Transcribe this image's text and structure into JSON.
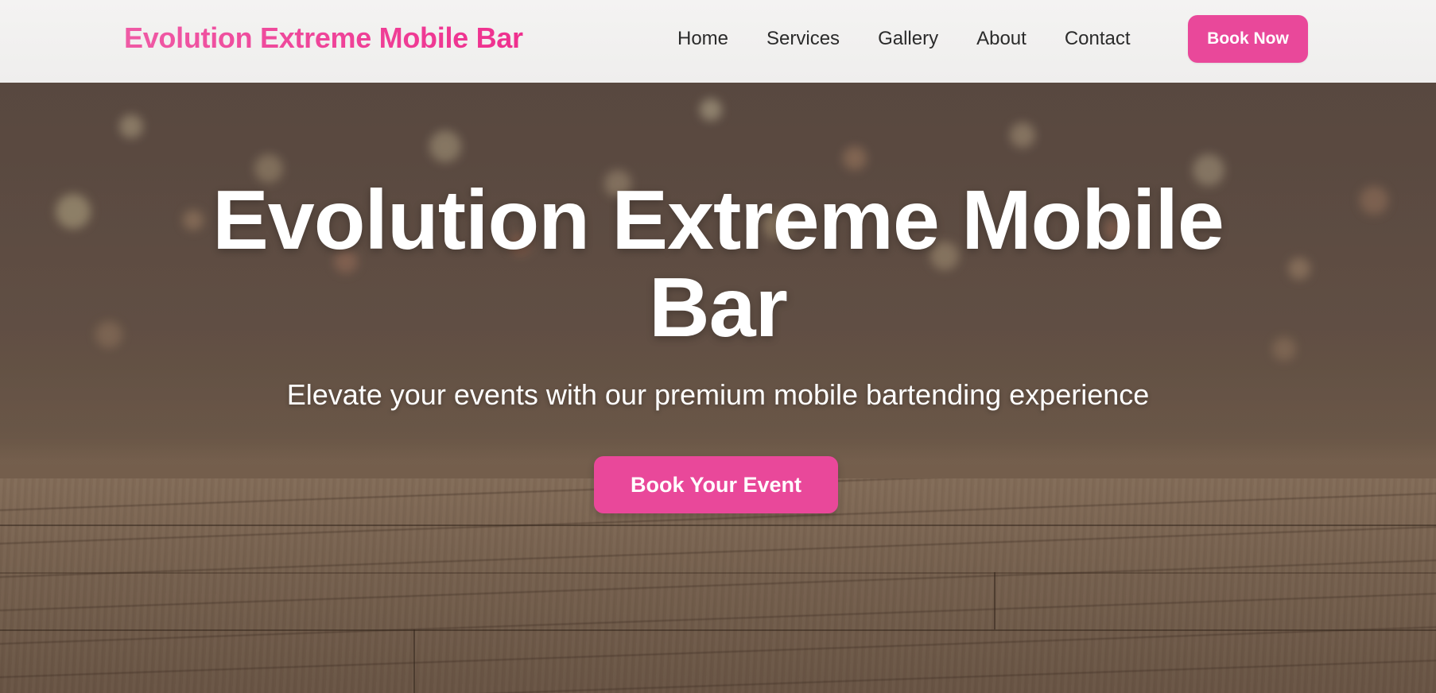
{
  "navbar": {
    "brand": "Evolution Extreme Mobile Bar",
    "links": [
      "Home",
      "Services",
      "Gallery",
      "About",
      "Contact"
    ],
    "cta_label": "Book Now"
  },
  "hero": {
    "title_line1": "Evolution Extreme Mobile",
    "title_line2": "Bar",
    "subtitle": "Elevate your events with our premium mobile bartending experience",
    "cta_label": "Book Your Event",
    "background": "blurred-bar-with-wooden-table-photo"
  },
  "colors": {
    "accent": "#e9489a",
    "brand_text": "#ef2f8e",
    "nav_bg": "#f2f1f0",
    "nav_text": "#2b2b2b",
    "hero_text": "#ffffff"
  }
}
